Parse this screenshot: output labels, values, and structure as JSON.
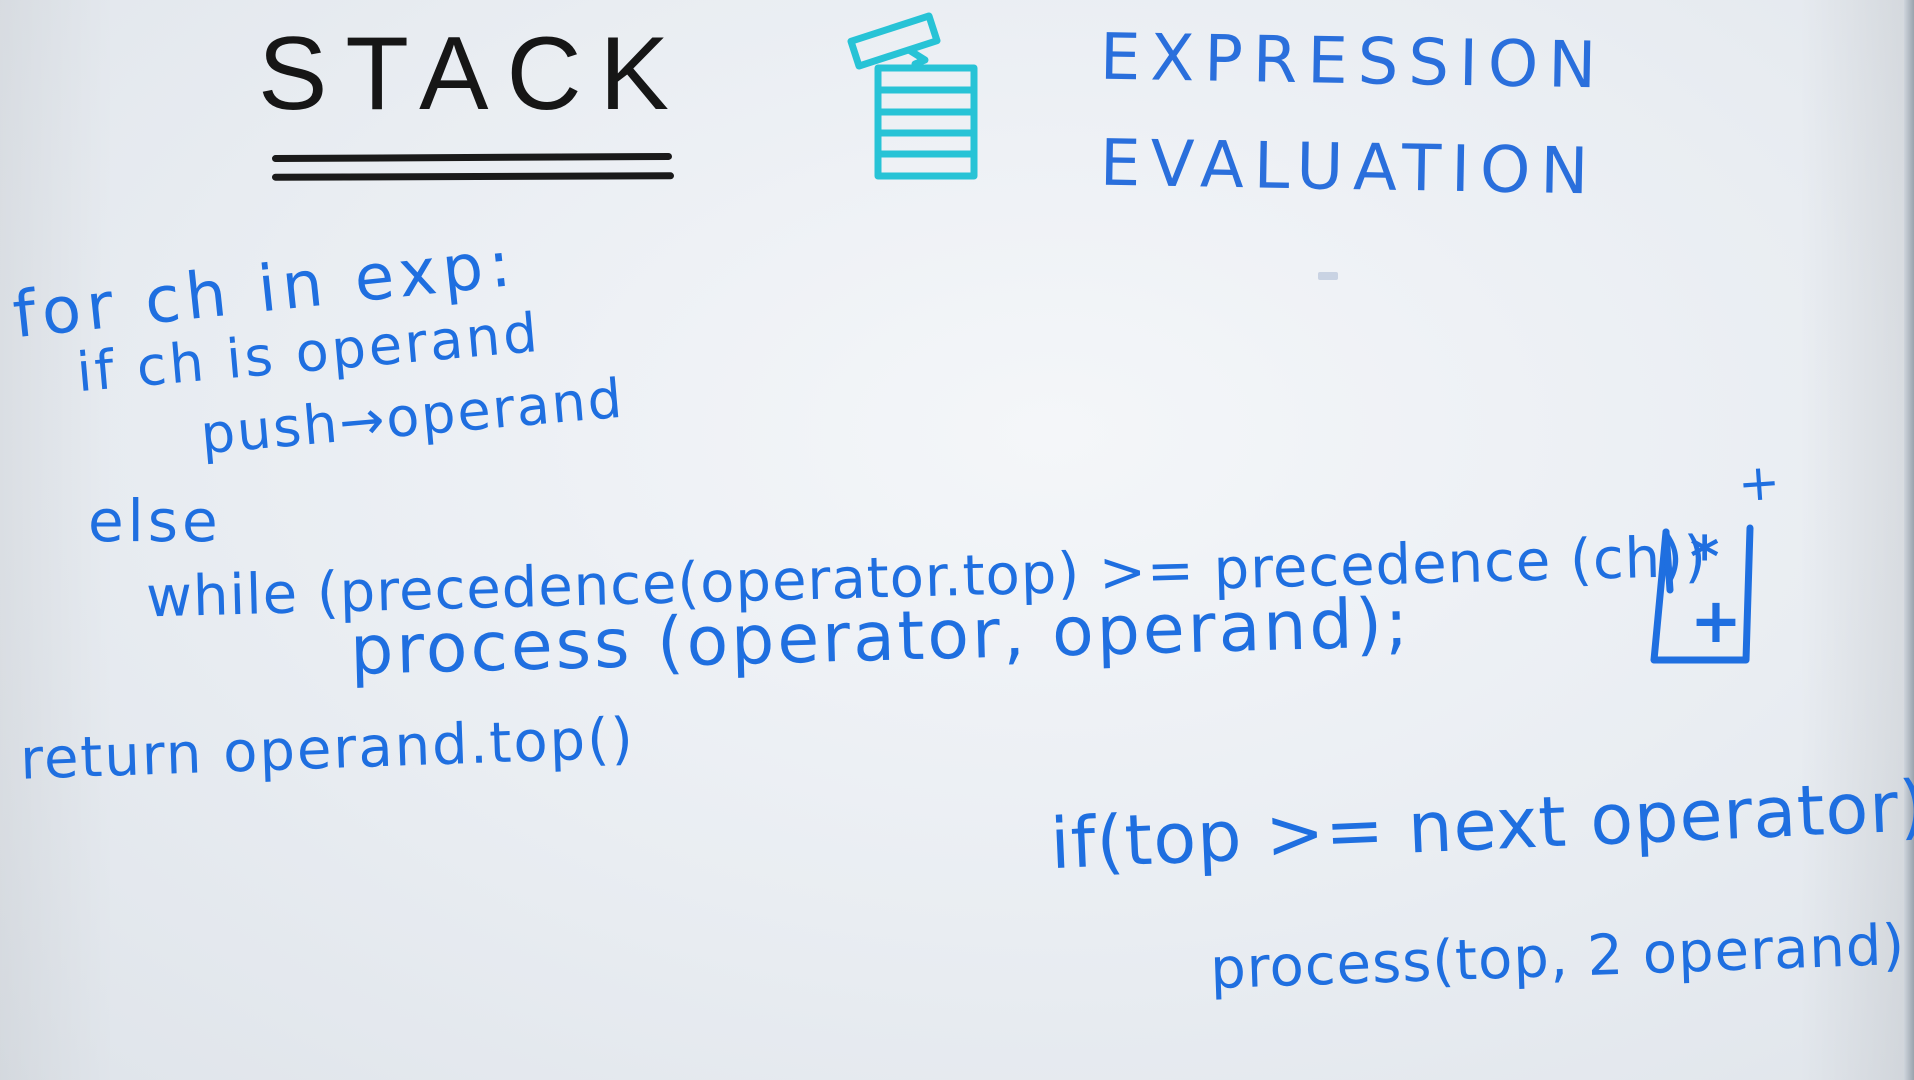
{
  "whiteboard": {
    "title": "STACK",
    "subtitle": {
      "line1": "Expression",
      "line2": "Evaluation"
    },
    "code": [
      "for ch in exp:",
      "if ch is operand",
      "push→operand",
      "else",
      "while (precedence(operator.top) >= precedence (ch))",
      "process (operator, operand);",
      "return operand.top()"
    ],
    "side_note": {
      "condition": "if(top >= next operator)",
      "action": "process(top, 2 operand)"
    },
    "stack_sketch": {
      "corner_mark": "+",
      "top_operator": "*",
      "bottom_operator": "+"
    }
  },
  "colors": {
    "board": "#eef1f5",
    "black_ink": "#161616",
    "blue_ink": "#1f6fe0",
    "teal_ink": "#27c3d6"
  },
  "icons": {
    "stack_icon": "stack-of-plates-icon",
    "operator_stack": "operator-stack-sketch"
  }
}
